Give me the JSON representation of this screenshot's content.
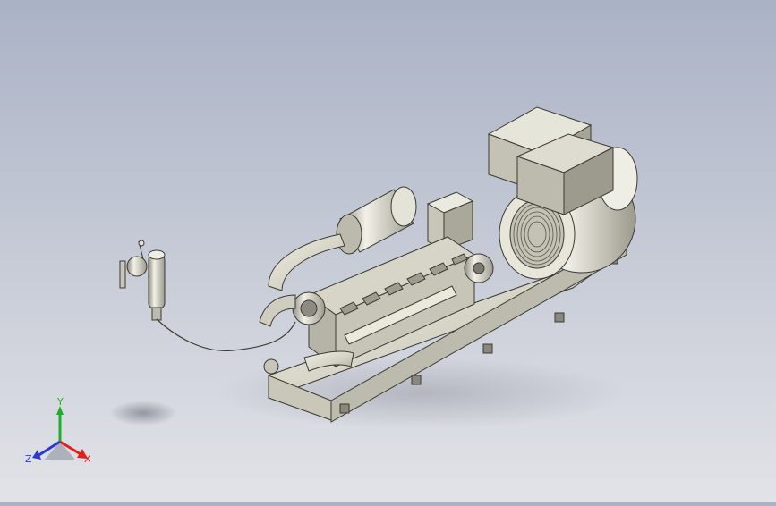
{
  "viewport": {
    "background_top": "#aab2c6",
    "background_bottom": "#e2e3e8",
    "model_shade": "#d8d6c8",
    "model_edge": "#3a3a34"
  },
  "triad": {
    "x_label": "X",
    "y_label": "Y",
    "z_label": "Z",
    "x_color": "#e0201c",
    "y_color": "#1fae2a",
    "z_color": "#2a3ad0"
  }
}
